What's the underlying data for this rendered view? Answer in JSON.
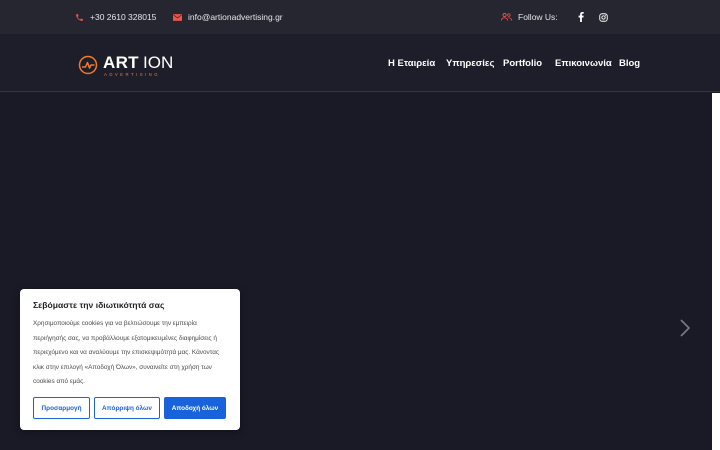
{
  "topbar": {
    "phone": "+30 2610 328015",
    "email": "info@artionadvertising.gr",
    "follow_label": "Follow Us:",
    "icons": {
      "phone": "phone-icon",
      "email": "envelope-icon",
      "follow": "users-icon",
      "facebook": "facebook-icon",
      "instagram": "instagram-icon"
    }
  },
  "header": {
    "logo": {
      "text_bold": "ART",
      "text_light": "ION",
      "subtitle": "ADVERTISING"
    },
    "nav": [
      {
        "label": "Η Εταιρεία"
      },
      {
        "label": "Υπηρεσίες"
      },
      {
        "label": "Portfolio"
      },
      {
        "label": "Επικοινωνία"
      },
      {
        "label": "Blog"
      }
    ]
  },
  "hero": {
    "next_icon": "chevron-right-icon"
  },
  "cookie_banner": {
    "title": "Σεβόμαστε την ιδιωτικότητά σας",
    "text": "Χρησιμοποιούμε cookies για να βελτιώσουμε την εμπειρία περιήγησής σας, να προβάλλουμε εξατομικευμένες διαφημίσεις ή περιεχόμενο και να αναλύουμε την επισκεψιμότητά μας. Κάνοντας κλικ στην επιλογή «Αποδοχή Όλων», συναινείτε στη χρήση των cookies από εμάς.",
    "buttons": {
      "customize": "Προσαρμογή",
      "reject": "Απόρριψη όλων",
      "accept": "Αποδοχή όλων"
    }
  },
  "colors": {
    "accent_orange": "#f07a2d",
    "icon_red": "#e8574a",
    "button_blue": "#1863dc",
    "topbar_bg": "#25262f",
    "header_bg": "#1d1e29",
    "hero_bg": "#1a1a26"
  }
}
